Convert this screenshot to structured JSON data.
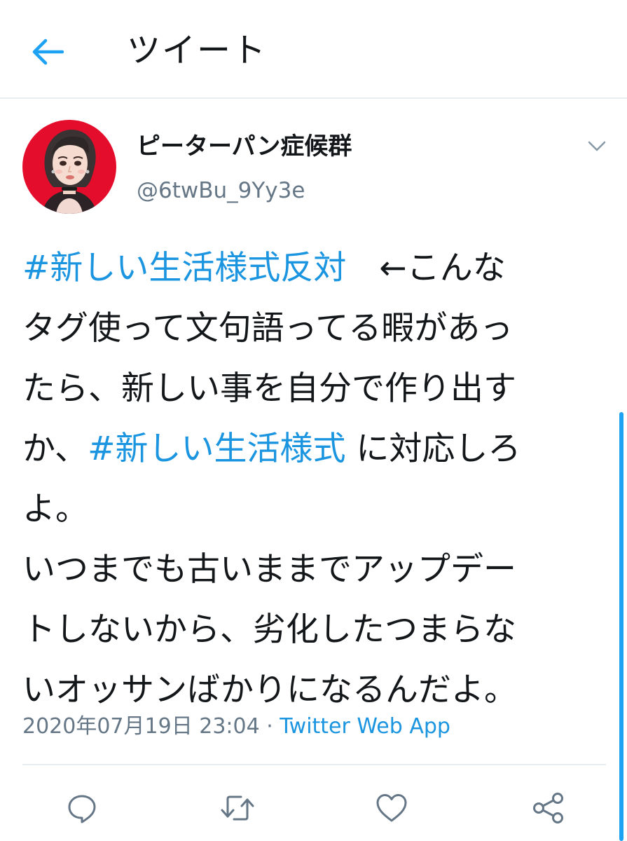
{
  "header": {
    "title": "ツイート",
    "back_icon": "arrow-left-icon",
    "accent": "#1da1f2"
  },
  "author": {
    "name": "ピーターパン症候群",
    "handle": "@6twBu_9Yy3e",
    "avatar_icon": "illustrated-portrait-avatar",
    "menu_icon": "chevron-down-icon"
  },
  "tweet": {
    "lines": [
      [
        {
          "text": "#新しい生活様式反対",
          "hashtag": true
        },
        {
          "text": "　←こんな",
          "hashtag": false
        }
      ],
      [
        {
          "text": "タグ使って文句語ってる暇があっ",
          "hashtag": false
        }
      ],
      [
        {
          "text": "たら、新しい事を自分で作り出す",
          "hashtag": false
        }
      ],
      [
        {
          "text": "か、",
          "hashtag": false
        },
        {
          "text": "#新しい生活様式",
          "hashtag": true
        },
        {
          "text": " に対応しろ",
          "hashtag": false
        }
      ],
      [
        {
          "text": "よ。",
          "hashtag": false
        }
      ],
      [
        {
          "text": "いつまでも古いままでアップデー",
          "hashtag": false
        }
      ],
      [
        {
          "text": "トしないから、劣化したつまらな",
          "hashtag": false
        }
      ],
      [
        {
          "text": "いオッサンばかりになるんだよ。",
          "hashtag": false
        }
      ]
    ],
    "hashtag_color": "#1b95e0"
  },
  "meta": {
    "timestamp": "2020年07月19日 23:04",
    "separator": " · ",
    "source": "Twitter Web App"
  },
  "actions": [
    {
      "name": "reply",
      "icon": "speech-bubble-icon"
    },
    {
      "name": "retweet",
      "icon": "retweet-arrows-icon"
    },
    {
      "name": "like",
      "icon": "heart-outline-icon"
    },
    {
      "name": "share",
      "icon": "share-nodes-icon"
    }
  ],
  "colors": {
    "text": "#14171a",
    "secondary": "#657786",
    "divider": "#e6ecf0",
    "icon": "#657786"
  }
}
